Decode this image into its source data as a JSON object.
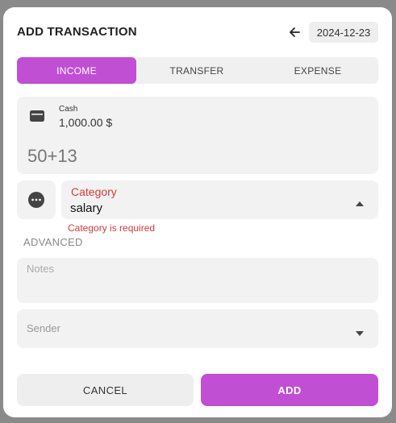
{
  "dialog": {
    "title": "ADD TRANSACTION",
    "date": "2024-12-23"
  },
  "tabs": [
    {
      "label": "INCOME",
      "active": true
    },
    {
      "label": "TRANSFER",
      "active": false
    },
    {
      "label": "EXPENSE",
      "active": false
    }
  ],
  "account": {
    "name": "Cash",
    "balance": "1,000.00 $",
    "icon": "wallet-icon"
  },
  "amount": {
    "value": "50+13"
  },
  "category": {
    "label": "Category",
    "value": "salary",
    "error": "Category is required",
    "icon": "more-horizontal-icon"
  },
  "advanced": {
    "label": "ADVANCED"
  },
  "notes": {
    "placeholder": "Notes"
  },
  "sender": {
    "label": "Sender"
  },
  "actions": {
    "cancel_label": "CANCEL",
    "add_label": "ADD"
  },
  "colors": {
    "accent": "#c04fd4",
    "error": "#d23b3b"
  }
}
